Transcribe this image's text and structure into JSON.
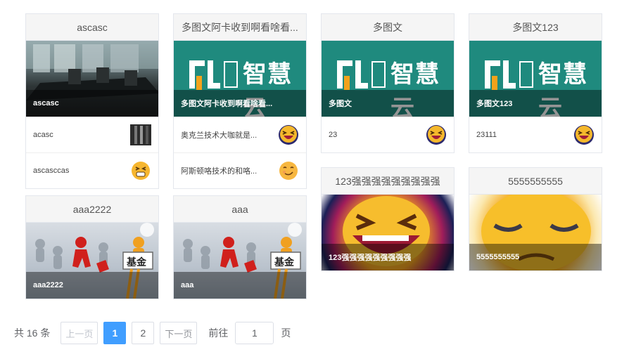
{
  "cards": [
    {
      "title": "ascasc",
      "cover_caption": "ascasc",
      "rows": [
        "acasc",
        "ascasccas"
      ]
    },
    {
      "title": "多图文阿卡收到啊看啥看...",
      "cover_caption": "多图文阿卡收到啊看啥看...",
      "rows": [
        "奥克兰技术大咖就是...",
        "阿斯顿咯技术的和咯..."
      ]
    },
    {
      "title": "多图文",
      "cover_caption": "多图文",
      "rows": [
        "23"
      ]
    },
    {
      "title": "多图文123",
      "cover_caption": "多图文123",
      "rows": [
        "23111"
      ]
    },
    {
      "title": "aaa2222",
      "cover_caption": "aaa2222"
    },
    {
      "title": "aaa",
      "cover_caption": "aaa"
    },
    {
      "title": "123强强强强强强强强强",
      "cover_caption": "123强强强强强强强强强"
    },
    {
      "title": "5555555555",
      "cover_caption": "5555555555"
    }
  ],
  "brand_logo_text": "智慧云",
  "fund_sign": "基金",
  "pagination": {
    "total": "共 16 条",
    "prev": "上一页",
    "pages": [
      "1",
      "2"
    ],
    "next": "下一页",
    "goto_prefix": "前往",
    "goto_value": "1",
    "goto_suffix": "页"
  }
}
